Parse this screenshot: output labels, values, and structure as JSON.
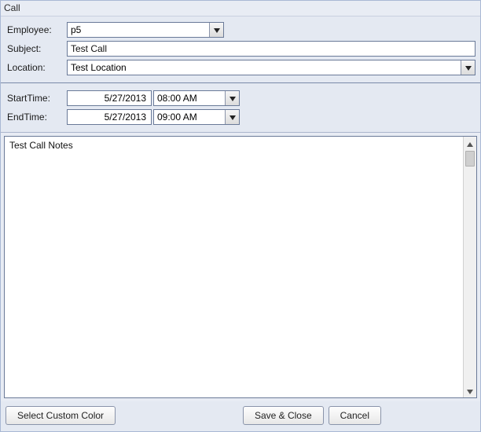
{
  "window": {
    "title": "Call"
  },
  "labels": {
    "employee": "Employee:",
    "subject": "Subject:",
    "location": "Location:",
    "startTime": "StartTime:",
    "endTime": "EndTime:"
  },
  "fields": {
    "employee": "p5",
    "subject": "Test Call",
    "location": "Test Location",
    "startDate": "5/27/2013",
    "startTime": "08:00 AM",
    "endDate": "5/27/2013",
    "endTime": "09:00 AM",
    "notes": "Test Call Notes"
  },
  "buttons": {
    "selectColor": "Select Custom Color",
    "saveClose": "Save & Close",
    "cancel": "Cancel"
  }
}
